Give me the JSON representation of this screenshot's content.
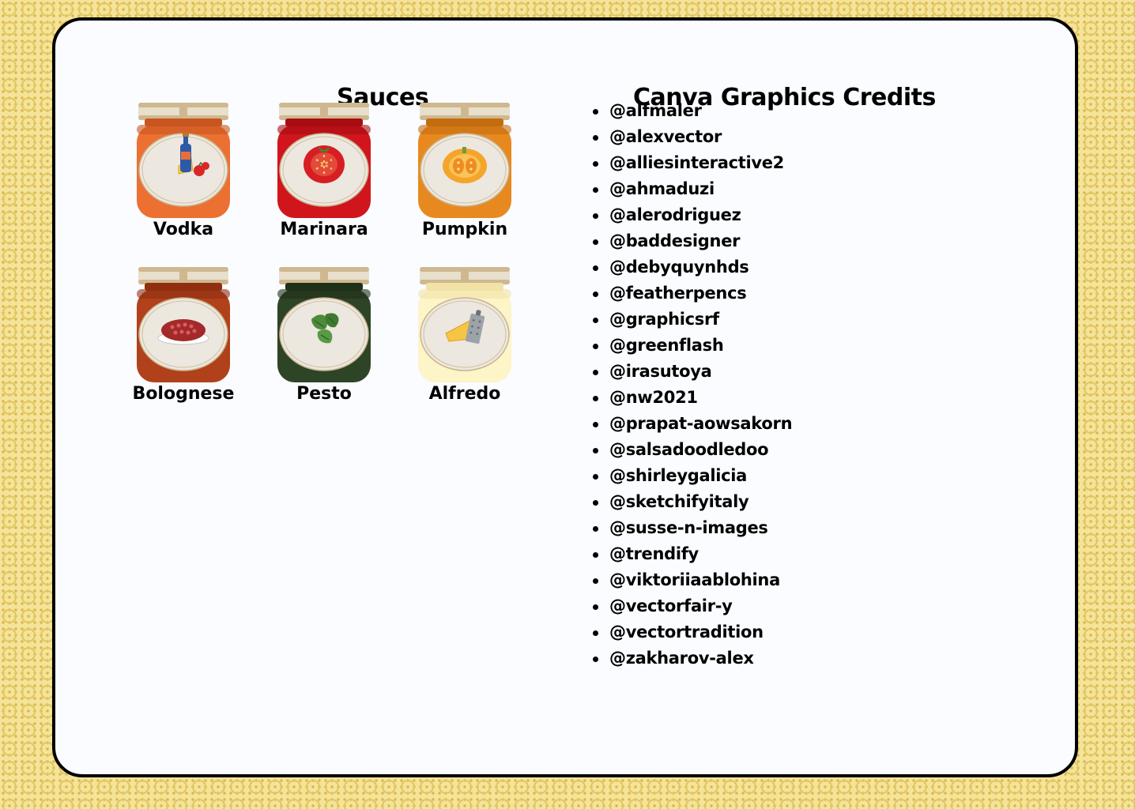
{
  "sauces": {
    "title": "Sauces",
    "items": [
      {
        "label": "Vodka",
        "color": "#ec7032",
        "dark": "#c9551f",
        "icon": "vodka-bottle-cheese-tomato-icon"
      },
      {
        "label": "Marinara",
        "color": "#d0161c",
        "dark": "#a80d12",
        "icon": "tomato-icon"
      },
      {
        "label": "Pumpkin",
        "color": "#e8891f",
        "dark": "#c46c10",
        "icon": "pumpkin-icon"
      },
      {
        "label": "Bolognese",
        "color": "#b0411a",
        "dark": "#8f2f10",
        "icon": "ground-meat-icon"
      },
      {
        "label": "Pesto",
        "color": "#2e4426",
        "dark": "#1f3019",
        "icon": "basil-leaves-icon"
      },
      {
        "label": "Alfredo",
        "color": "#fdf4c8",
        "dark": "#f1e3a6",
        "icon": "cheese-grater-icon"
      }
    ]
  },
  "credits": {
    "title": "Canva Graphics Credits",
    "items": [
      "@alfmaler",
      "@alexvector",
      "@alliesinteractive2",
      "@ahmaduzi",
      "@alerodriguez",
      "@baddesigner",
      "@debyquynhds",
      "@featherpencs",
      "@graphicsrf",
      "@greenflash",
      "@irasutoya",
      "@nw2021",
      "@prapat-aowsakorn",
      "@salsadoodledoo",
      "@shirleygalicia",
      "@sketchifyitaly",
      "@susse-n-images",
      "@trendify",
      "@viktoriiaablohina",
      "@vectorfair-y",
      "@vectortradition",
      "@zakharov-alex"
    ]
  },
  "colors": {
    "lid": "#e8dfcc",
    "lid_band": "#cfb88f",
    "label_oval": "#ece7df",
    "label_rim": "#c9b48d",
    "frame_border": "#000000",
    "card_bg": "#fafcff"
  }
}
